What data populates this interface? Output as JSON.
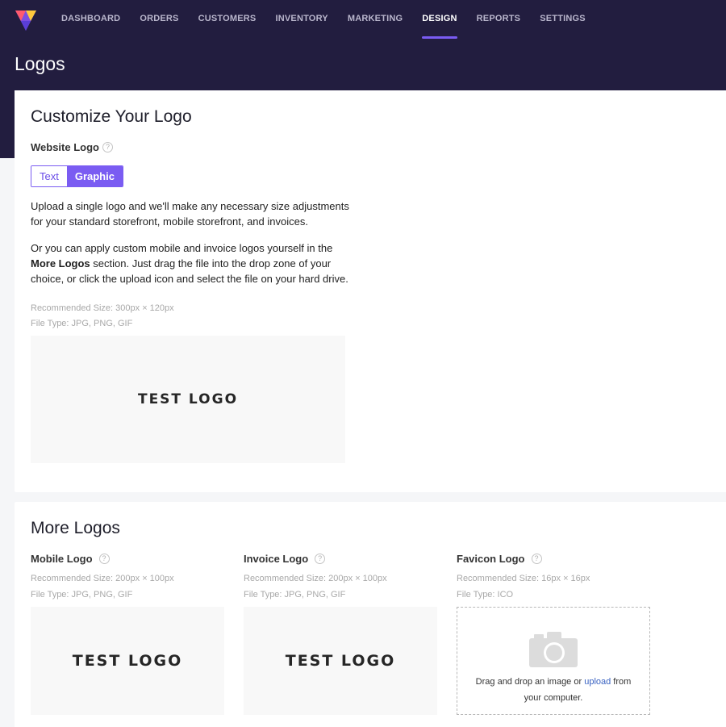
{
  "nav": {
    "items": [
      "DASHBOARD",
      "ORDERS",
      "CUSTOMERS",
      "INVENTORY",
      "MARKETING",
      "DESIGN",
      "REPORTS",
      "SETTINGS"
    ],
    "active": "DESIGN"
  },
  "page": {
    "title": "Logos"
  },
  "customize": {
    "title": "Customize Your Logo",
    "website_logo_label": "Website Logo",
    "help_glyph": "?",
    "toggle_text": "Text",
    "toggle_graphic": "Graphic",
    "para1": "Upload a single logo and we'll make any necessary size adjustments for your standard storefront, mobile storefront, and invoices.",
    "para2_before": "Or you can apply custom mobile and invoice logos yourself in the ",
    "para2_bold": "More Logos",
    "para2_after": " section. Just drag the file into the drop zone of your choice, or click the upload icon and select the file on your hard drive.",
    "recommended_size": "Recommended Size: 300px × 120px",
    "file_type": "File Type: JPG, PNG, GIF",
    "preview_text": "TEST LOGO"
  },
  "more": {
    "title": "More Logos",
    "mobile": {
      "label": "Mobile Logo",
      "recommended_size": "Recommended Size: 200px × 100px",
      "file_type": "File Type: JPG, PNG, GIF",
      "preview_text": "TEST LOGO"
    },
    "invoice": {
      "label": "Invoice Logo",
      "recommended_size": "Recommended Size: 200px × 100px",
      "file_type": "File Type: JPG, PNG, GIF",
      "preview_text": "TEST LOGO"
    },
    "favicon": {
      "label": "Favicon Logo",
      "recommended_size": "Recommended Size: 16px × 16px",
      "file_type": "File Type: ICO",
      "drop_before": "Drag and drop an image or ",
      "drop_link": "upload",
      "drop_after": " from your computer."
    }
  },
  "colors": {
    "header_bg": "#221d3f",
    "accent": "#7a5cf2",
    "link": "#3a63c2"
  },
  "icons": [
    "brand-logo-icon",
    "help-icon",
    "camera-icon"
  ]
}
